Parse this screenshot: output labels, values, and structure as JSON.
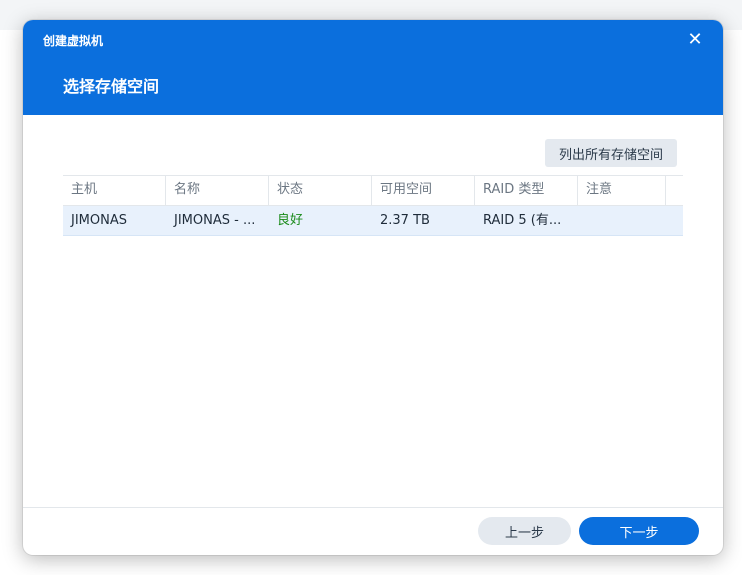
{
  "dialog": {
    "window_title": "创建虚拟机",
    "step_title": "选择存储空间",
    "close_icon": "close-icon",
    "list_all_button": "列出所有存储空间",
    "footer": {
      "prev_label": "上一步",
      "next_label": "下一步"
    }
  },
  "table": {
    "columns": [
      "主机",
      "名称",
      "状态",
      "可用空间",
      "RAID 类型",
      "注意"
    ],
    "rows": [
      {
        "host": "JIMONAS",
        "name": "JIMONAS - ...",
        "status": "良好",
        "free_space": "2.37 TB",
        "raid_type": "RAID 5 (有...",
        "note": ""
      }
    ]
  },
  "colors": {
    "header_bg": "#0b6fdd",
    "primary_button": "#0b6fdd",
    "status_ok": "#1a8a1a",
    "selected_row": "#e8f1fc"
  }
}
